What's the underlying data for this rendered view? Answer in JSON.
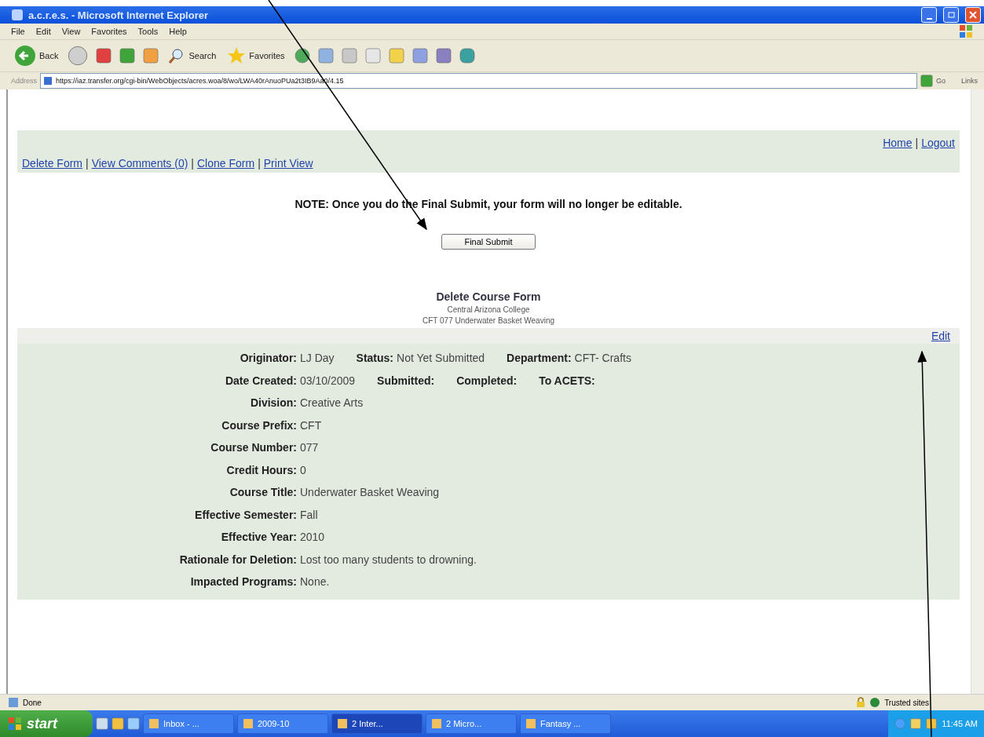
{
  "window": {
    "title": "a.c.r.e.s. - Microsoft Internet Explorer"
  },
  "menu": [
    "File",
    "Edit",
    "View",
    "Favorites",
    "Tools",
    "Help"
  ],
  "toolbar": {
    "back": "Back",
    "search": "Search",
    "favorites": "Favorites"
  },
  "address": {
    "label": "Address",
    "url": "https://iaz.transfer.org/cgi-bin/WebObjects/acres.woa/8/wo/LWA40rAnuoPUa2t3IB9Aa0/4.15",
    "go": "Go",
    "links": "Links"
  },
  "page": {
    "top_links": [
      "Home",
      "Logout"
    ],
    "separator": "|",
    "nav_links": [
      "Delete Form",
      "View Comments (0)",
      "Clone Form",
      "Print View"
    ],
    "note": "NOTE: Once you do the Final Submit, your form will no longer be editable.",
    "submit_button": "Final Submit",
    "form_title": "Delete Course Form",
    "college": "Central Arizona College",
    "course": "CFT 077 Underwater Basket Weaving",
    "edit_link": "Edit",
    "rows": [
      {
        "pairs": [
          {
            "label": "Originator:",
            "value": "LJ Day"
          },
          {
            "label": "Status:",
            "value": "Not Yet Submitted"
          },
          {
            "label": "Department:",
            "value": "CFT- Crafts"
          }
        ]
      },
      {
        "pairs": [
          {
            "label": "Date Created:",
            "value": "03/10/2009"
          },
          {
            "label": "Submitted:"
          },
          {
            "label": "Completed:"
          },
          {
            "label": "To ACETS:"
          }
        ]
      },
      {
        "pairs": [
          {
            "label": "Division:",
            "value": "Creative Arts"
          }
        ]
      },
      {
        "pairs": [
          {
            "label": "Course Prefix:",
            "value": "CFT"
          }
        ]
      },
      {
        "pairs": [
          {
            "label": "Course Number:",
            "value": "077"
          }
        ]
      },
      {
        "pairs": [
          {
            "label": "Credit Hours:",
            "value": "0"
          }
        ]
      },
      {
        "pairs": [
          {
            "label": "Course Title:",
            "value": "Underwater Basket Weaving"
          }
        ]
      },
      {
        "pairs": [
          {
            "label": "Effective Semester:",
            "value": "Fall"
          }
        ]
      },
      {
        "pairs": [
          {
            "label": "Effective Year:",
            "value": "2010"
          }
        ]
      },
      {
        "pairs": [
          {
            "label": "Rationale for Deletion:",
            "value": "Lost too many students to drowning."
          }
        ]
      },
      {
        "pairs": [
          {
            "label": "Impacted Programs:",
            "value": "None."
          }
        ]
      }
    ]
  },
  "status_bar": {
    "text": "Done",
    "zone": "Trusted sites"
  },
  "taskbar": {
    "start": "start",
    "tasks": [
      "Inbox - ...",
      "2009-10",
      "2 Inter...",
      "2 Micro...",
      "Fantasy ..."
    ],
    "clock": "11:45 AM"
  }
}
